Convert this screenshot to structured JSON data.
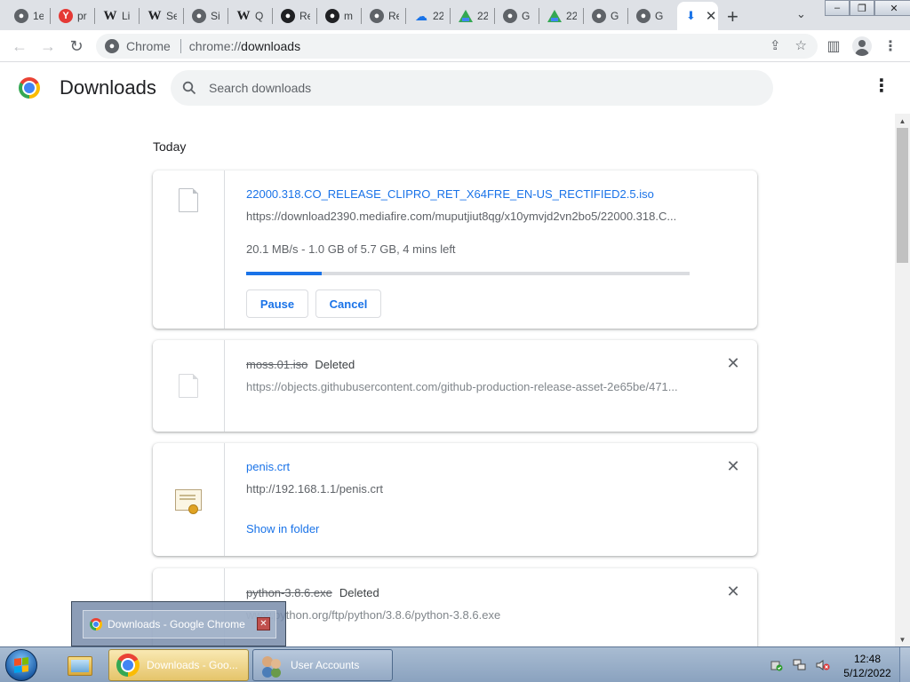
{
  "tabs": [
    {
      "icon": "globe-icon",
      "glyph": "●",
      "text": "1е"
    },
    {
      "icon": "yandex-icon",
      "glyph": "Y",
      "text": "pr"
    },
    {
      "icon": "wikipedia-icon",
      "glyph": "W",
      "text": "Li"
    },
    {
      "icon": "wikipedia-icon",
      "glyph": "W",
      "text": "Se"
    },
    {
      "icon": "globe-icon",
      "glyph": "●",
      "text": "Si"
    },
    {
      "icon": "wikipedia-icon",
      "glyph": "W",
      "text": "Q"
    },
    {
      "icon": "github-icon",
      "glyph": "●",
      "text": "Re"
    },
    {
      "icon": "github-icon",
      "glyph": "●",
      "text": "m"
    },
    {
      "icon": "globe-icon",
      "glyph": "●",
      "text": "Re"
    },
    {
      "icon": "cloud-icon",
      "glyph": "☁",
      "text": "22"
    },
    {
      "icon": "drive-icon",
      "glyph": "",
      "text": "22"
    },
    {
      "icon": "globe-icon",
      "glyph": "●",
      "text": "G"
    },
    {
      "icon": "drive-icon",
      "glyph": "",
      "text": "22"
    },
    {
      "icon": "globe-icon",
      "glyph": "●",
      "text": "G"
    },
    {
      "icon": "globe-icon",
      "glyph": "●",
      "text": "G"
    }
  ],
  "active_tab": {
    "icon": "download-icon",
    "glyph": "⬇",
    "close": "✕"
  },
  "new_tab_glyph": "+",
  "tab_search_glyph": "⌄",
  "window_controls": {
    "minimize": "–",
    "restore": "❐",
    "close": "✕"
  },
  "toolbar": {
    "back": "←",
    "forward": "→",
    "reload": "↻",
    "site_label": "Chrome",
    "url_scheme": "chrome://",
    "url_host": "downloads",
    "share_glyph": "⇪",
    "star_glyph": "☆",
    "sidepanel_glyph": "▥",
    "menu_glyph": "⋮"
  },
  "page": {
    "title": "Downloads",
    "search_placeholder": "Search downloads",
    "menu_glyph": "⋮",
    "date_label": "Today"
  },
  "downloads": [
    {
      "filename": "22000.318.CO_RELEASE_CLIPRO_RET_X64FRE_EN-US_RECTIFIED2.5.iso",
      "url": "https://download2390.mediafire.com/muputjiut8qg/x10ymvjd2vn2bo5/22000.318.C...",
      "progress_text": "20.1 MB/s - 1.0 GB of 5.7 GB, 4 mins left",
      "progress_fraction": 0.17,
      "pause_label": "Pause",
      "cancel_label": "Cancel"
    },
    {
      "filename": "moss.01.iso",
      "status": "Deleted",
      "url": "https://objects.githubusercontent.com/github-production-release-asset-2e65be/471...",
      "close_glyph": "✕"
    },
    {
      "filename": "penis.crt",
      "url": "http://192.168.1.1/penis.crt",
      "link_label": "Show in folder",
      "close_glyph": "✕"
    },
    {
      "filename": "python-3.8.6.exe",
      "status": "Deleted",
      "url": "www.python.org/ftp/python/3.8.6/python-3.8.6.exe",
      "close_glyph": "✕"
    }
  ],
  "scrollbar": {
    "up": "▲",
    "down": "▼"
  },
  "thumbnail_popup": {
    "label": "Downloads - Google Chrome",
    "close": "✕"
  },
  "taskbar": {
    "chrome_label": "Downloads - Goo...",
    "users_label": "User Accounts",
    "clock_time": "12:48",
    "clock_date": "5/12/2022"
  }
}
